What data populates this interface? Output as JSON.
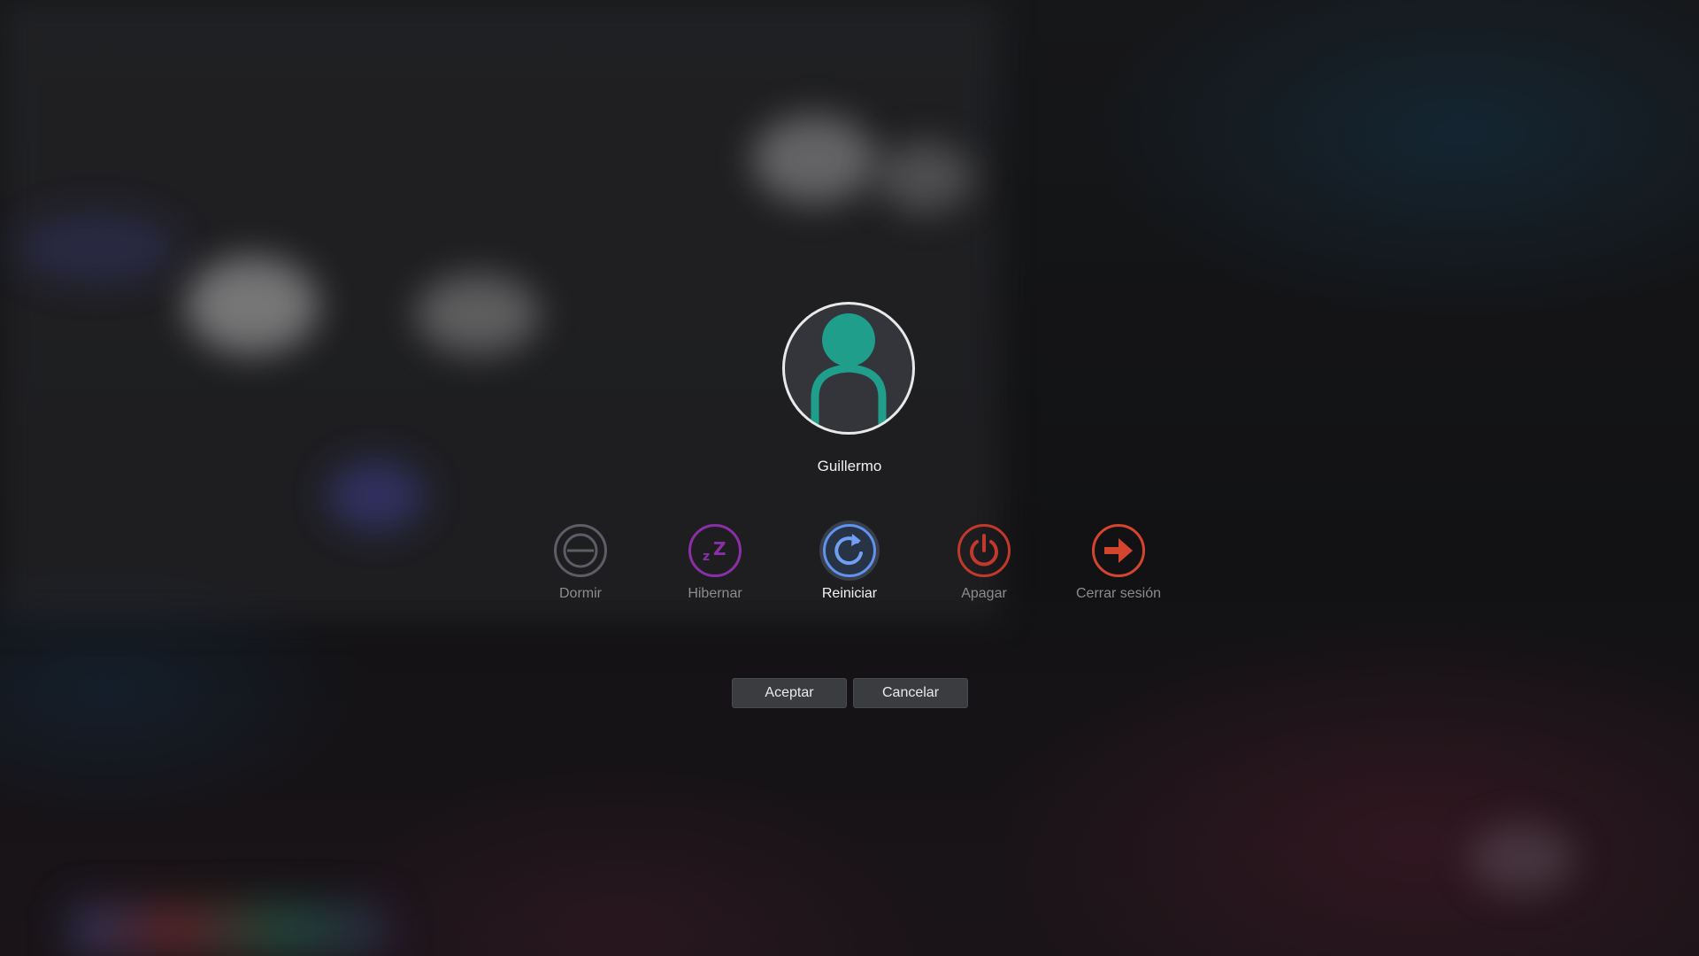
{
  "user": {
    "name": "Guillermo",
    "avatar_icon": "user-avatar-icon",
    "avatar_color": "#1f9e8c"
  },
  "actions": [
    {
      "label": "Dormir",
      "icon": "sleep-icon",
      "color": "#5c5d66",
      "active": false
    },
    {
      "label": "Hibernar",
      "icon": "hibernate-icon",
      "color": "#8a2fa6",
      "active": false
    },
    {
      "label": "Reiniciar",
      "icon": "restart-icon",
      "color": "#5f93f0",
      "active": true
    },
    {
      "label": "Apagar",
      "icon": "power-icon",
      "color": "#c0392b",
      "active": false
    },
    {
      "label": "Cerrar sesión",
      "icon": "logout-icon",
      "color": "#d4452e",
      "active": false
    }
  ],
  "buttons": {
    "accept": "Aceptar",
    "cancel": "Cancelar"
  }
}
